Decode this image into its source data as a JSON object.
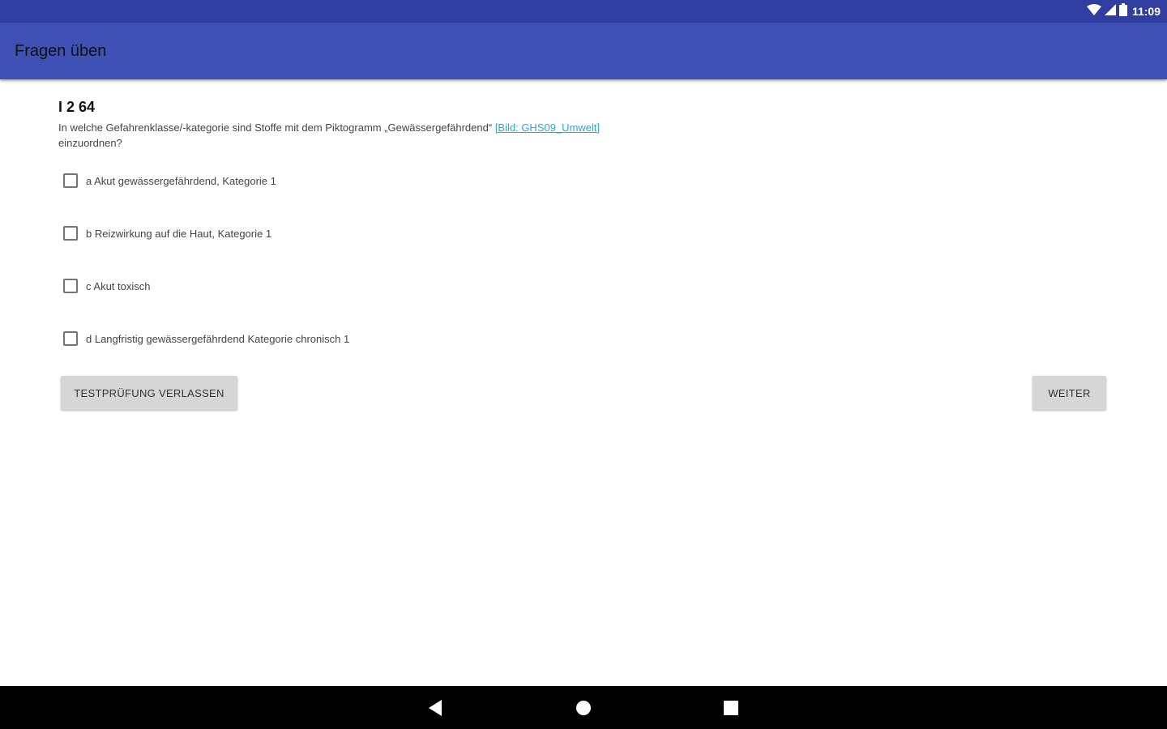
{
  "status_bar": {
    "time": "11:09",
    "icons": [
      "wifi-icon",
      "signal-icon",
      "battery-icon"
    ]
  },
  "app_bar": {
    "title": "Fragen üben"
  },
  "question": {
    "id": "I 2 64",
    "text": "In welche Gefahrenklasse/-kategorie sind Stoffe mit dem Piktogramm „Gewässergefährdend“",
    "link": "[Bild: GHS09_Umwelt]",
    "text_end": "einzuordnen?"
  },
  "answers": [
    {
      "label": "a Akut gewässergefährdend, Kategorie 1",
      "checked": false
    },
    {
      "label": "b Reizwirkung auf die Haut, Kategorie 1",
      "checked": false
    },
    {
      "label": "c Akut toxisch",
      "checked": false
    },
    {
      "label": "d Langfristig gewässergefährdend Kategorie chronisch 1",
      "checked": false
    }
  ],
  "buttons": {
    "leave": "TESTPRÜFUNG VERLASSEN",
    "next": "WEITER"
  },
  "nav": {
    "icons": [
      "back-icon",
      "home-icon",
      "recents-icon"
    ]
  },
  "colors": {
    "status_bar": "#303f9f",
    "app_bar": "#3f51b5",
    "link": "#2aa8d8",
    "button": "#d6d6d6"
  }
}
